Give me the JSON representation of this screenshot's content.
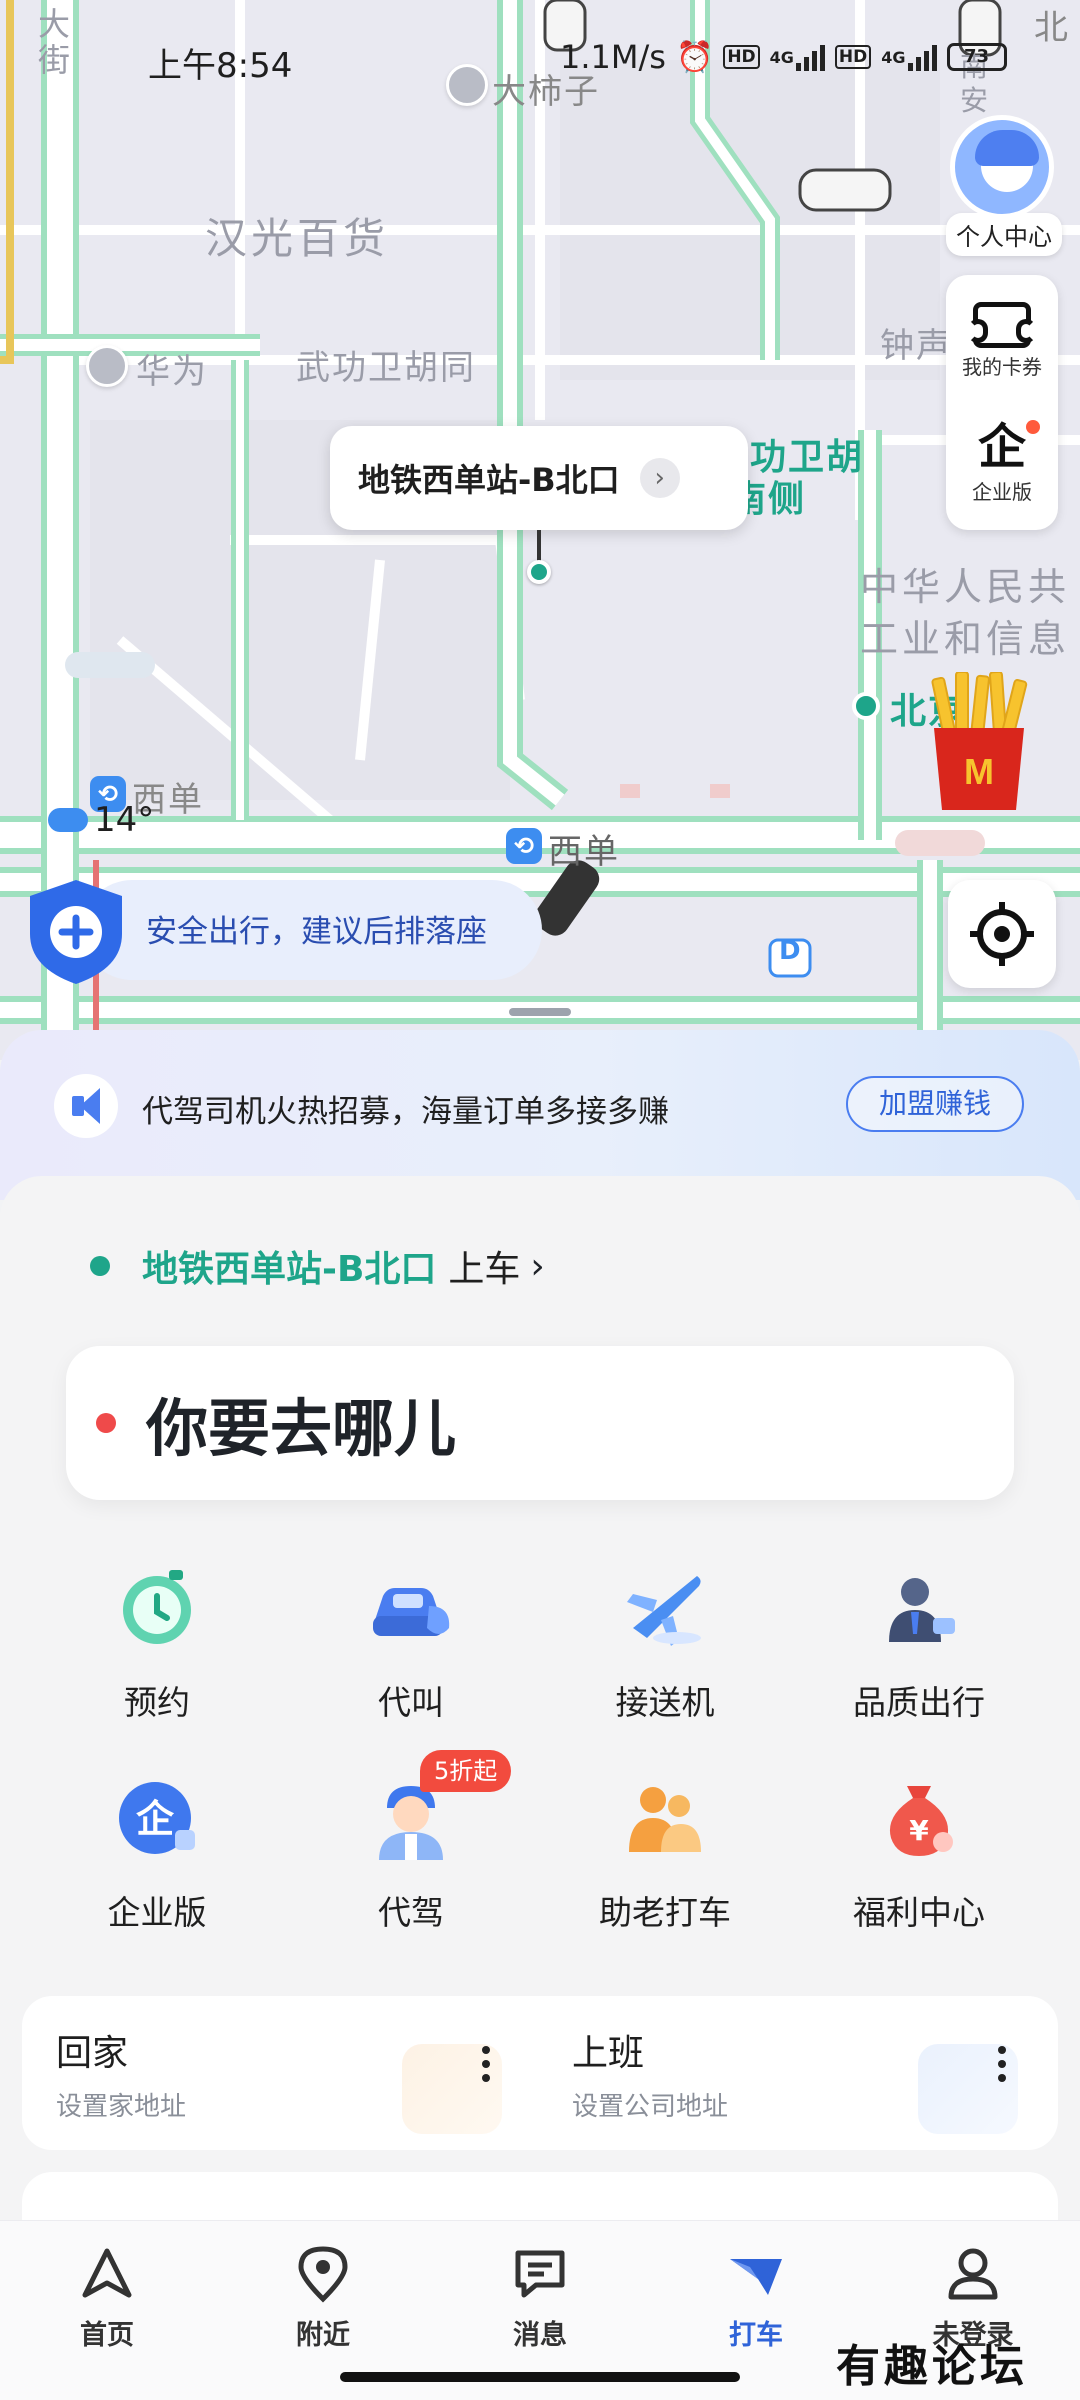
{
  "status_bar": {
    "time": "上午8:54",
    "speed": "1.1M/s",
    "hd1": "HD",
    "net1": "4G",
    "hd2": "HD",
    "net2": "4G",
    "battery": "73"
  },
  "map": {
    "labels": {
      "street_vertical": "大\n街",
      "poi_dashizi": "大柿子",
      "hanguang": "汉光百货",
      "huawei": "华为",
      "wugongwei": "武功卫胡同",
      "wugongwei_south": "功卫胡",
      "wugongwei_south2": "南侧",
      "zhongshan": "钟声",
      "ministry1": "中华人民共",
      "ministry2": "工业和信息",
      "beijing": "北京",
      "xidan_metro1": "西单",
      "xidan_metro2": "西单",
      "north_edge": "北",
      "xian": "南\n安",
      "d_marker": "D"
    },
    "pickup_bubble": "地铁西单站-B北口",
    "weather_temp": "14°",
    "safety_tip": "安全出行，建议后排落座",
    "profile_label": "个人中心",
    "side_panel": {
      "coupons_label": "我的卡券",
      "enterprise_label": "企业版",
      "enterprise_icon_text": "企"
    }
  },
  "promo": {
    "text": "代驾司机火热招募，海量订单多接多赚",
    "button": "加盟赚钱"
  },
  "booking": {
    "pickup_location": "地铁西单站-B北口",
    "pickup_suffix": "上车",
    "destination_placeholder": "你要去哪儿"
  },
  "services": [
    {
      "label": "预约",
      "icon": "clock-icon"
    },
    {
      "label": "代叫",
      "icon": "car-call-icon"
    },
    {
      "label": "接送机",
      "icon": "airplane-icon"
    },
    {
      "label": "品质出行",
      "icon": "business-person-icon"
    },
    {
      "label": "企业版",
      "icon": "enterprise-icon"
    },
    {
      "label": "代驾",
      "icon": "driver-icon",
      "badge": "5折起"
    },
    {
      "label": "助老打车",
      "icon": "elderly-icon"
    },
    {
      "label": "福利中心",
      "icon": "money-bag-icon"
    }
  ],
  "quick": {
    "home_title": "回家",
    "home_sub": "设置家地址",
    "work_title": "上班",
    "work_sub": "设置公司地址"
  },
  "tabs": [
    {
      "label": "首页",
      "icon": "home-icon",
      "active": false
    },
    {
      "label": "附近",
      "icon": "location-pin-icon",
      "active": false
    },
    {
      "label": "消息",
      "icon": "message-icon",
      "active": false
    },
    {
      "label": "打车",
      "icon": "taxi-icon",
      "active": true
    },
    {
      "label": "未登录",
      "icon": "user-icon",
      "active": false
    }
  ],
  "watermark": "有趣论坛",
  "colors": {
    "accent_blue": "#2f63d8",
    "teal": "#1ea58a",
    "red_dot": "#ef4a4a",
    "badge_red": "#f24b3e"
  }
}
